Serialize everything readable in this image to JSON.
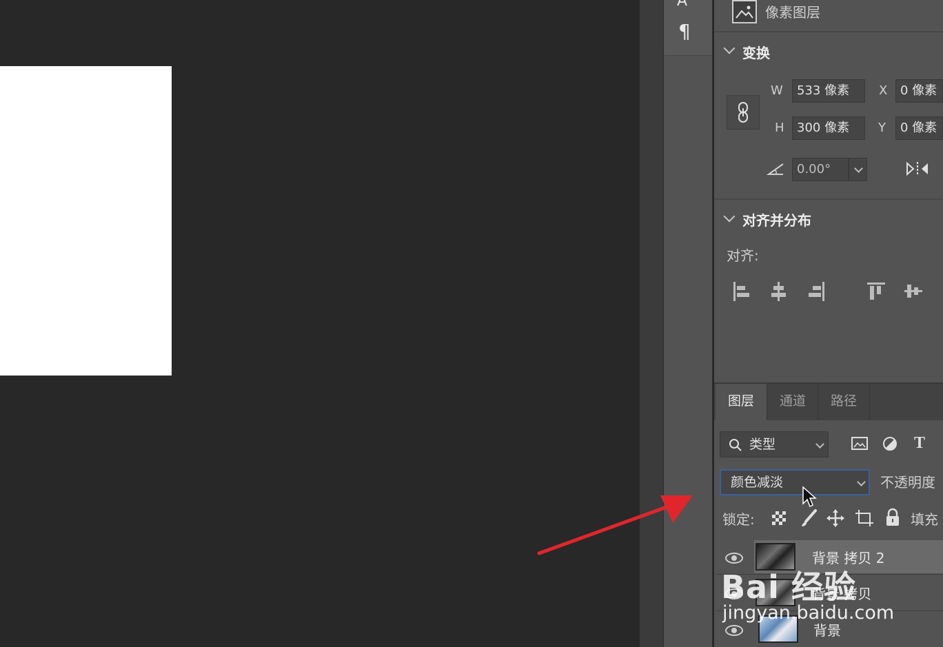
{
  "properties": {
    "layer_kind": "像素图层",
    "transform": {
      "title": "变换",
      "w_label": "W",
      "w_value": "533 像素",
      "h_label": "H",
      "h_value": "300 像素",
      "x_label": "X",
      "x_value": "0 像素",
      "y_label": "Y",
      "y_value": "0 像素",
      "angle_value": "0.00°"
    },
    "align": {
      "title": "对齐并分布",
      "align_label": "对齐:"
    }
  },
  "layers_panel": {
    "tabs": [
      {
        "label": "图层",
        "active": true
      },
      {
        "label": "通道",
        "active": false
      },
      {
        "label": "路径",
        "active": false
      }
    ],
    "filter_label": "类型",
    "blend_mode": "颜色减淡",
    "opacity_label": "不透明度",
    "lock_label": "锁定:",
    "fill_label": "填充",
    "layers": [
      {
        "name": "背景 拷贝 2",
        "selected": true
      },
      {
        "name": "背景 拷贝",
        "selected": false
      },
      {
        "name": "背景",
        "selected": false
      }
    ]
  },
  "watermark": {
    "logo_text": "Bai 经验",
    "url": "jingyan.baidu.com"
  },
  "colors": {
    "canvas_bg": "#282828",
    "panel_bg": "#535353",
    "arrow": "#e0262c"
  }
}
